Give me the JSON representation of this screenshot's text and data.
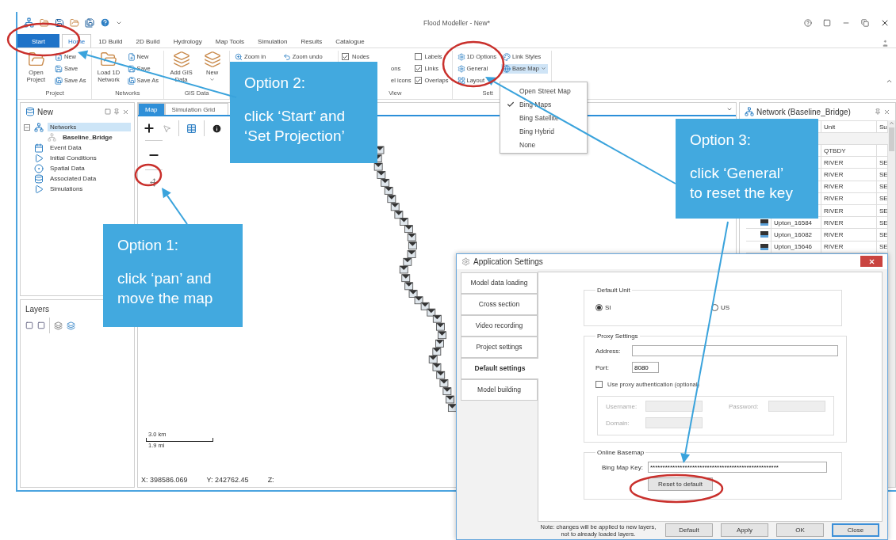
{
  "window": {
    "title": "Flood Modeller - New*"
  },
  "ribbon_tabs": [
    {
      "label": "Start",
      "kind": "backstage",
      "selected": false
    },
    {
      "label": "Home",
      "kind": "tab",
      "selected": true
    },
    {
      "label": "1D Build",
      "kind": "tab",
      "selected": false
    },
    {
      "label": "2D Build",
      "kind": "tab",
      "selected": false
    },
    {
      "label": "Hydrology",
      "kind": "tab",
      "selected": false
    },
    {
      "label": "Map Tools",
      "kind": "tab",
      "selected": false
    },
    {
      "label": "Simulation",
      "kind": "tab",
      "selected": false
    },
    {
      "label": "Results",
      "kind": "tab",
      "selected": false
    },
    {
      "label": "Catalogue",
      "kind": "tab",
      "selected": false
    }
  ],
  "ribbon_groups": [
    {
      "label": "Project",
      "items": [
        {
          "kind": "large",
          "label": "Open Project"
        },
        {
          "kind": "small",
          "label": "New"
        },
        {
          "kind": "small",
          "label": "Save"
        },
        {
          "kind": "small",
          "label": "Save As"
        }
      ]
    },
    {
      "label": "Networks",
      "items": [
        {
          "kind": "large",
          "label": "Load 1D Network"
        },
        {
          "kind": "small",
          "label": "New"
        },
        {
          "kind": "small",
          "label": "Save"
        },
        {
          "kind": "small",
          "label": "Save As"
        }
      ]
    },
    {
      "label": "GIS Data",
      "items": [
        {
          "kind": "large",
          "label": "Add GIS Data"
        },
        {
          "kind": "menu_large",
          "label": "New"
        }
      ]
    },
    {
      "items": [
        {
          "kind": "small",
          "label": "Zoom in"
        },
        {
          "kind": "small",
          "label": "Zoom undo"
        }
      ]
    },
    {
      "label": "View",
      "items": [
        {
          "kind": "check",
          "label": "Nodes",
          "checked": true
        },
        {
          "kind": "fragment",
          "label": "ons"
        },
        {
          "kind": "fragment",
          "label": "el icons"
        },
        {
          "kind": "check",
          "label": "Labels",
          "checked": false
        },
        {
          "kind": "check",
          "label": "Links",
          "checked": true
        },
        {
          "kind": "check",
          "label": "Overlaps",
          "checked": true
        }
      ]
    },
    {
      "label": "Sett",
      "items": [
        {
          "kind": "small",
          "label": "1D Options"
        },
        {
          "kind": "small",
          "label": "General"
        },
        {
          "kind": "menu",
          "label": "Layout",
          "expanded": false
        },
        {
          "kind": "small",
          "label": "Link Styles"
        },
        {
          "kind": "menu",
          "label": "Base Map",
          "expanded": true
        }
      ]
    }
  ],
  "base_map_menu": [
    {
      "label": "Open Street Map",
      "checked": false
    },
    {
      "label": "Bing Maps",
      "checked": true
    },
    {
      "label": "Bing Satellite",
      "checked": false
    },
    {
      "label": "Bing Hybrid",
      "checked": false
    },
    {
      "label": "None",
      "checked": false
    }
  ],
  "project_panel": {
    "title": "New",
    "tree": [
      {
        "label": "Networks",
        "selected": true,
        "expanded": true,
        "children": [
          {
            "label": "Baseline_Bridge",
            "selected": false
          }
        ]
      },
      {
        "label": "Event Data",
        "selected": false
      },
      {
        "label": "Initial Conditions",
        "selected": false
      },
      {
        "label": "Spatial Data",
        "selected": false
      },
      {
        "label": "Associated Data",
        "selected": false
      },
      {
        "label": "Simulations",
        "selected": false
      }
    ]
  },
  "layers_panel": {
    "title": "Layers"
  },
  "map_view": {
    "tabs": [
      {
        "label": "Map",
        "selected": true
      },
      {
        "label": "Simulation Grid",
        "selected": false
      }
    ],
    "scale": [
      "3.0 km",
      "1.9 mi"
    ],
    "status": [
      "X: 398586.069",
      "Y: 242762.45",
      "Z:"
    ]
  },
  "network_panel": {
    "title": "Network (Baseline_Bridge)",
    "columns": [
      "Unit",
      "Su"
    ],
    "rows": [
      {
        "unit": "QTBDY"
      },
      {
        "unit": "RIVER",
        "column_3": "SE"
      },
      {
        "unit": "RIVER",
        "column_3": "SE"
      },
      {
        "unit": "RIVER",
        "column_3": "SE"
      },
      {
        "unit": "RIVER",
        "column_3": "SE"
      },
      {
        "unit": "RIVER",
        "column_3": "SE"
      },
      {
        "name": "Upton_16584",
        "unit": "RIVER",
        "column_3": "SE"
      },
      {
        "name": "Upton_16082",
        "unit": "RIVER",
        "column_3": "SE"
      },
      {
        "name": "Upton_15646",
        "unit": "RIVER",
        "column_3": "SE"
      }
    ]
  },
  "dialog": {
    "title": "Application Settings",
    "tabs": [
      {
        "label": "Model data loading",
        "selected": false
      },
      {
        "label": "Cross section",
        "selected": false
      },
      {
        "label": "Video recording",
        "selected": false
      },
      {
        "label": "Project settings",
        "selected": false
      },
      {
        "label": "Default settings",
        "selected": true
      },
      {
        "label": "Model building",
        "selected": false
      }
    ],
    "default_unit": {
      "label": "Default Unit",
      "options": [
        {
          "label": "SI",
          "selected": true
        },
        {
          "label": "US",
          "selected": false
        }
      ]
    },
    "proxy": {
      "label": "Proxy Settings",
      "address_label": "Address:",
      "port_label": "Port:",
      "port": "8080",
      "auth": {
        "label": "Use proxy authentication (optional)",
        "checked": false
      },
      "username_label": "Username:",
      "password_label": "Password:",
      "domain_label": "Domain:"
    },
    "basemap": {
      "label": "Online Basemap",
      "key_label": "Bing Map Key:",
      "key": "****************************************************",
      "reset": "Reset to default"
    },
    "note": "Note: changes will be applied to new layers,\nnot to already loaded layers.",
    "buttons": [
      {
        "label": "Default",
        "selected": false
      },
      {
        "label": "Apply",
        "selected": false
      },
      {
        "label": "OK",
        "selected": false
      },
      {
        "label": "Close",
        "selected": true
      }
    ]
  },
  "callouts": [
    {
      "title": "Option 2:",
      "text": "click ‘Start’ and\n‘Set Projection’"
    },
    {
      "title": "Option 3:",
      "text": "click ‘General’\nto reset the key"
    },
    {
      "title": "Option 1:",
      "text": "click ‘pan’ and\nmove the map"
    }
  ]
}
